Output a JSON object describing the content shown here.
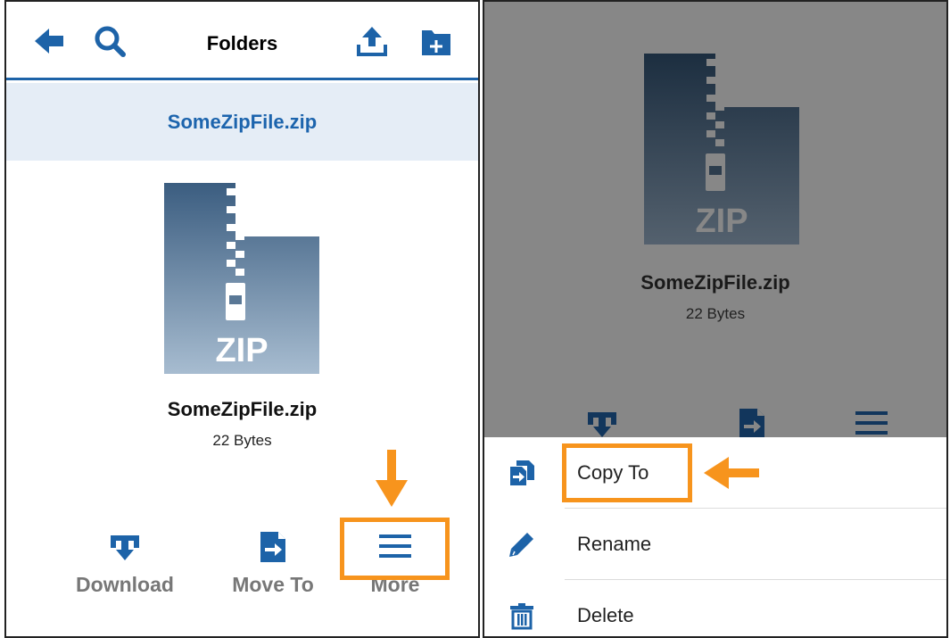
{
  "left": {
    "header": {
      "title": "Folders",
      "back_icon": "back-arrow-icon",
      "search_icon": "search-icon",
      "upload_icon": "upload-icon",
      "new_folder_icon": "new-folder-icon"
    },
    "file_title": "SomeZipFile.zip",
    "file": {
      "name": "SomeZipFile.zip",
      "size": "22 Bytes",
      "badge": "ZIP"
    },
    "actions": [
      {
        "label": "Download",
        "icon": "download-icon"
      },
      {
        "label": "Move To",
        "icon": "move-to-icon"
      },
      {
        "label": "More",
        "icon": "hamburger-menu-icon"
      }
    ]
  },
  "right": {
    "file": {
      "name": "SomeZipFile.zip",
      "size": "22 Bytes",
      "badge": "ZIP"
    },
    "menu": [
      {
        "label": "Copy To",
        "icon": "copy-to-icon"
      },
      {
        "label": "Rename",
        "icon": "pencil-icon"
      },
      {
        "label": "Delete",
        "icon": "trash-icon"
      }
    ]
  },
  "colors": {
    "brand_blue": "#1d63a8",
    "title_band": "#e5edf6",
    "highlight_orange": "#f7941d",
    "overlay_gray": "#878787"
  }
}
